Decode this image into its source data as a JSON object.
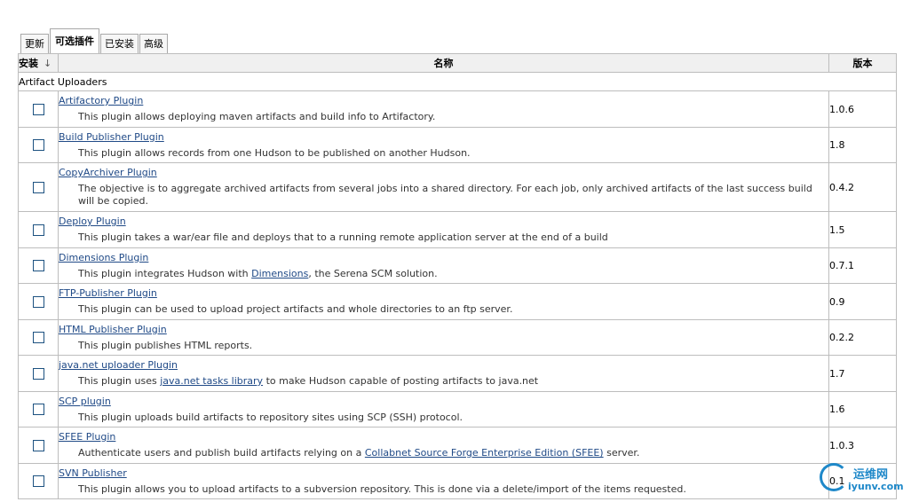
{
  "tabs": [
    {
      "label": "更新"
    },
    {
      "label": "可选插件"
    },
    {
      "label": "已安装"
    },
    {
      "label": "高级"
    }
  ],
  "table": {
    "headers": {
      "install": "安装",
      "sort_arrow": "↓",
      "name": "名称",
      "version": "版本"
    },
    "category": "Artifact Uploaders",
    "rows": [
      {
        "name": "Artifactory Plugin",
        "desc": "This plugin allows deploying maven artifacts and build info to Artifactory.",
        "version": "1.0.6"
      },
      {
        "name": "Build Publisher Plugin",
        "desc": "This plugin allows records from one Hudson to be published on another Hudson.",
        "version": "1.8"
      },
      {
        "name": "CopyArchiver Plugin",
        "desc": "The objective is to aggregate archived artifacts from several jobs into a shared directory. For each job, only archived artifacts of the last success build will be copied.",
        "version": "0.4.2"
      },
      {
        "name": "Deploy Plugin",
        "desc": "This plugin takes a war/ear file and deploys that to a running remote application server at the end of a build",
        "version": "1.5"
      },
      {
        "name": "Dimensions Plugin",
        "desc_before": "This plugin integrates Hudson with ",
        "desc_link": "Dimensions",
        "desc_after": ", the Serena SCM solution.",
        "version": "0.7.1"
      },
      {
        "name": "FTP-Publisher Plugin",
        "desc": "This plugin can be used to upload project artifacts and whole directories to an ftp server.",
        "version": "0.9"
      },
      {
        "name": "HTML Publisher Plugin",
        "desc": "This plugin publishes HTML reports.",
        "version": "0.2.2"
      },
      {
        "name": "java.net uploader Plugin",
        "desc_before": "This plugin uses ",
        "desc_link": "java.net tasks library",
        "desc_after": " to make Hudson capable of posting artifacts to java.net",
        "version": "1.7"
      },
      {
        "name": "SCP plugin",
        "desc": "This plugin uploads build artifacts to repository sites using SCP (SSH) protocol.",
        "version": "1.6"
      },
      {
        "name": "SFEE Plugin",
        "desc_before": "Authenticate users and publish build artifacts relying on a ",
        "desc_link": "Collabnet Source Forge Enterprise Edition (SFEE)",
        "desc_after": " server.",
        "version": "1.0.3"
      },
      {
        "name": "SVN Publisher",
        "desc": "This plugin allows you to upload artifacts to a subversion repository. This is done via a delete/import of the items requested.",
        "version": "0.1"
      }
    ]
  },
  "watermark": {
    "title": "运维网",
    "url": "iyunv.com"
  },
  "colors": {
    "link": "#204a87",
    "header_bg": "#f0f0f0",
    "border": "#bdbdbd",
    "watermark": "#1e88c9"
  }
}
